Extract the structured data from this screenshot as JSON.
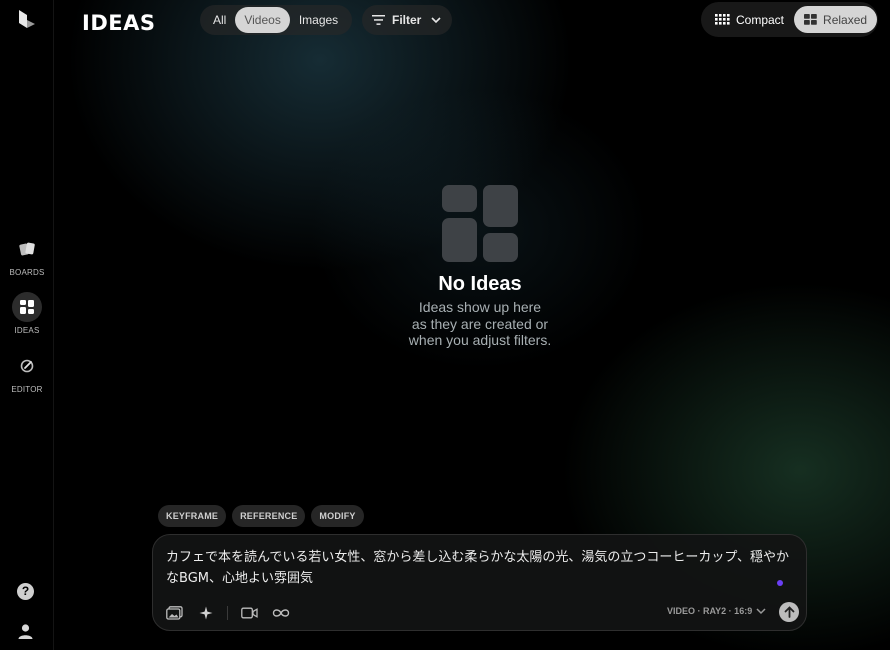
{
  "app": {
    "brand": "IDEAS"
  },
  "sidebar": {
    "items": [
      {
        "label": "BOARDS",
        "icon": "boards-icon"
      },
      {
        "label": "IDEAS",
        "icon": "ideas-icon",
        "active": true
      },
      {
        "label": "EDITOR",
        "icon": "editor-icon"
      }
    ],
    "help": "?"
  },
  "header": {
    "media_filter": {
      "options": [
        "All",
        "Videos",
        "Images"
      ],
      "selected": "Videos"
    },
    "filter_label": "Filter",
    "layout": {
      "options": [
        "Compact",
        "Relaxed"
      ],
      "selected": "Relaxed"
    }
  },
  "empty_state": {
    "title": "No Ideas",
    "message_lines": [
      "Ideas show up here",
      "as they are created or",
      "when you adjust filters."
    ]
  },
  "prompt": {
    "chips": [
      "KEYFRAME",
      "REFERENCE",
      "MODIFY"
    ],
    "text": "カフェで本を読んでいる若い女性、窓から差し込む柔らかな太陽の光、湯気の立つコーヒーカップ、穏やかなBGM、心地よい雰囲気",
    "model_label": "VIDEO · RAY2 · 16:9"
  },
  "colors": {
    "accent_dot": "#6b3ff5",
    "selected_pill": "#d5d5d5"
  }
}
